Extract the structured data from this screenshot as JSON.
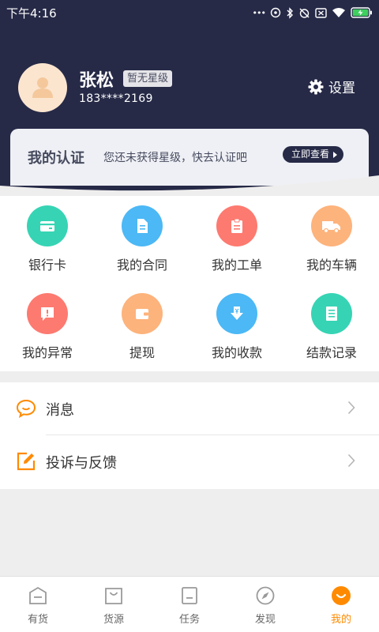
{
  "status_bar": {
    "time": "下午4:16",
    "dots": "•••"
  },
  "profile": {
    "name": "张松",
    "level_badge": "暂无星级",
    "phone": "183****2169",
    "settings_label": "设置"
  },
  "certification": {
    "title": "我的认证",
    "description": "您还未获得星级，快去认证吧",
    "button_label": "立即查看"
  },
  "grid": [
    {
      "label": "银行卡",
      "icon": "bank-card-icon",
      "color": "#36d4b4"
    },
    {
      "label": "我的合同",
      "icon": "contract-icon",
      "color": "#4cb8f5"
    },
    {
      "label": "我的工单",
      "icon": "work-order-icon",
      "color": "#fd7a70"
    },
    {
      "label": "我的车辆",
      "icon": "truck-icon",
      "color": "#fdb37c"
    },
    {
      "label": "我的异常",
      "icon": "exception-icon",
      "color": "#fd7a70"
    },
    {
      "label": "提现",
      "icon": "wallet-icon",
      "color": "#fdb37c"
    },
    {
      "label": "我的收款",
      "icon": "receive-money-icon",
      "color": "#4cb8f5"
    },
    {
      "label": "结款记录",
      "icon": "settlement-record-icon",
      "color": "#36d4b4"
    }
  ],
  "menu": {
    "messages_label": "消息",
    "feedback_label": "投诉与反馈"
  },
  "tabs": [
    {
      "label": "有货"
    },
    {
      "label": "货源"
    },
    {
      "label": "任务"
    },
    {
      "label": "发现"
    },
    {
      "label": "我的"
    }
  ],
  "colors": {
    "header_bg": "#262a47",
    "accent": "#ff8a00",
    "page_bg": "#efeeee"
  }
}
